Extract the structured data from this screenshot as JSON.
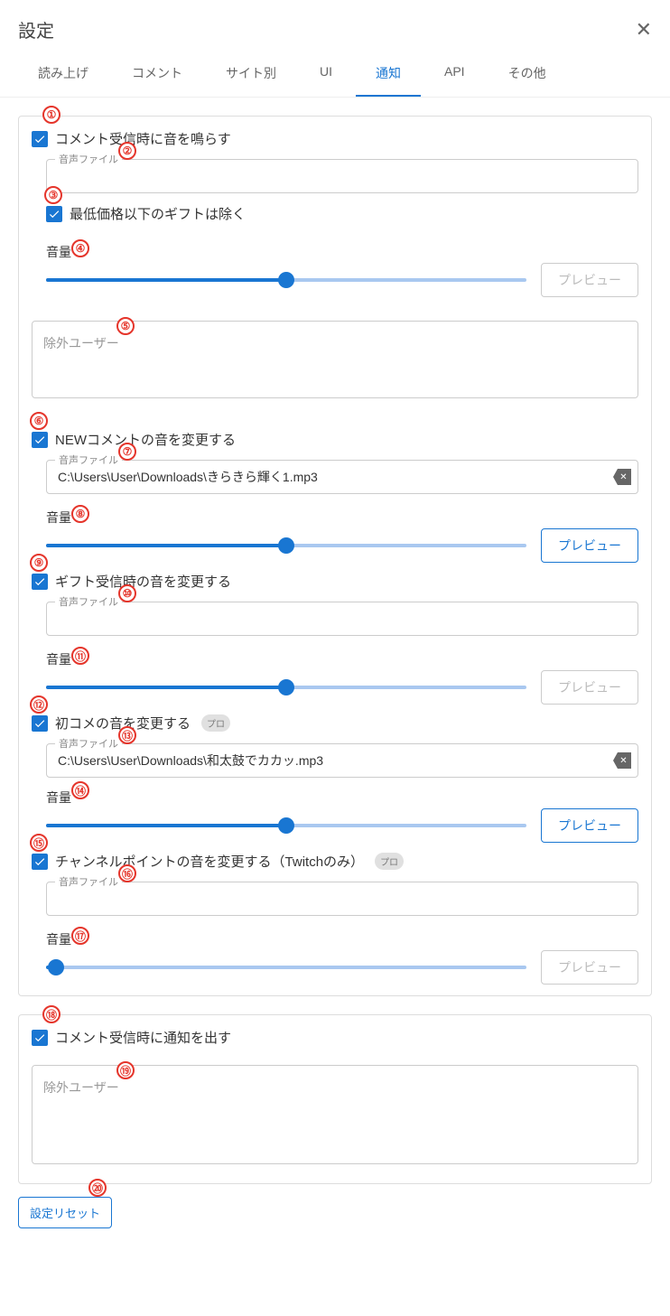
{
  "header": {
    "title": "設定"
  },
  "tabs": [
    {
      "label": "読み上げ"
    },
    {
      "label": "コメント"
    },
    {
      "label": "サイト別"
    },
    {
      "label": "UI"
    },
    {
      "label": "通知",
      "active": true
    },
    {
      "label": "API"
    },
    {
      "label": "その他"
    }
  ],
  "s1": {
    "check_label": "コメント受信時に音を鳴らす",
    "file_label": "音声ファイル",
    "file_value": "",
    "sub_check_label": "最低価格以下のギフトは除く",
    "vol_label": "音量",
    "vol_pct": 50,
    "preview": "プレビュー",
    "exclude_placeholder": "除外ユーザー"
  },
  "s2": {
    "check_label": "NEWコメントの音を変更する",
    "file_label": "音声ファイル",
    "file_value": "C:\\Users\\User\\Downloads\\きらきら輝く1.mp3",
    "vol_label": "音量",
    "vol_pct": 50,
    "preview": "プレビュー"
  },
  "s3": {
    "check_label": "ギフト受信時の音を変更する",
    "file_label": "音声ファイル",
    "file_value": "",
    "vol_label": "音量",
    "vol_pct": 50,
    "preview": "プレビュー"
  },
  "s4": {
    "check_label": "初コメの音を変更する",
    "pro": "プロ",
    "file_label": "音声ファイル",
    "file_value": "C:\\Users\\User\\Downloads\\和太鼓でカカッ.mp3",
    "vol_label": "音量",
    "vol_pct": 50,
    "preview": "プレビュー"
  },
  "s5": {
    "check_label": "チャンネルポイントの音を変更する（Twitchのみ）",
    "pro": "プロ",
    "file_label": "音声ファイル",
    "file_value": "",
    "vol_label": "音量",
    "vol_pct": 2,
    "preview": "プレビュー"
  },
  "s6": {
    "check_label": "コメント受信時に通知を出す",
    "exclude_placeholder": "除外ユーザー"
  },
  "footer": {
    "reset": "設定リセット"
  },
  "annotations": {
    "1": "①",
    "2": "②",
    "3": "③",
    "4": "④",
    "5": "⑤",
    "6": "⑥",
    "7": "⑦",
    "8": "⑧",
    "9": "⑨",
    "10": "⑩",
    "11": "⑪",
    "12": "⑫",
    "13": "⑬",
    "14": "⑭",
    "15": "⑮",
    "16": "⑯",
    "17": "⑰",
    "18": "⑱",
    "19": "⑲",
    "20": "⑳"
  }
}
